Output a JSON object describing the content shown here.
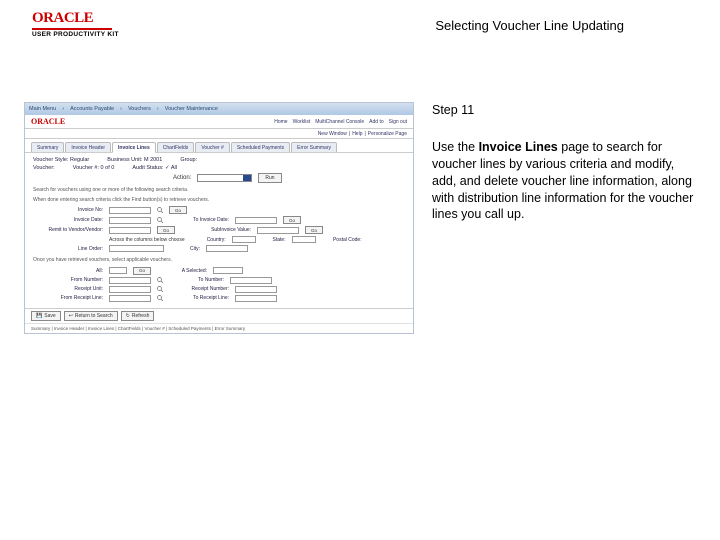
{
  "header": {
    "logo_text": "ORACLE",
    "logo_subtitle": "USER PRODUCTIVITY KIT",
    "title": "Selecting Voucher Line Updating"
  },
  "right_panel": {
    "step_label": "Step 11",
    "body_before_bold": "Use the ",
    "body_bold": "Invoice Lines",
    "body_after_bold": " page to search for voucher lines by various criteria and modify, add, and delete voucher line information, along with distribution line information for the voucher lines you call up."
  },
  "mini": {
    "breadcrumb": [
      "Main Menu",
      "Accounts Payable",
      "Vouchers",
      "Voucher Maintenance"
    ],
    "oracle_logo": "ORACLE",
    "top_links": [
      "Home",
      "Worklist",
      "MultiChannel Console",
      "Add to",
      "Sign out"
    ],
    "subbar_links": [
      "New Window",
      "Help",
      "Personalize Page"
    ],
    "tabs": [
      "Summary",
      "Invoice Header",
      "Invoice Lines",
      "ChartFields",
      "Voucher #",
      "Scheduled Payments",
      "Error Summary"
    ],
    "active_tab_index": 2,
    "header_fields": {
      "style_label": "Voucher Style:",
      "style_value": "Regular",
      "bu_label": "Business Unit:",
      "bu_value": "M 2001",
      "group_label": "Group:",
      "voucher_label": "Voucher:",
      "voucher_value": "",
      "voucher_label2": "Voucher #:",
      "voucher_value2": "0 of 0",
      "audit_label": "Audit Status:",
      "audit_value": "✓ All"
    },
    "action_label": "Action:",
    "run_btn": "Run",
    "instr1": "Search for vouchers using one or more of the following search criteria.",
    "instr2": "When done entering search criteria click the Find button(s) to retrieve vouchers.",
    "rows": [
      {
        "l1": "Invoice No:",
        "go": "Go"
      },
      {
        "l1": "Invoice Date:",
        "l2": "To Invoice Date:",
        "go": "Go"
      },
      {
        "l1": "Remit to Vendor/Vendor:",
        "go": "Go",
        "l2": "SubInvoice Value:",
        "go2": "Go"
      },
      {
        "l1": "",
        "mid": "Across the columns below choose",
        "l2": "Country:",
        "l3": "State:",
        "l4": "Postal Code:"
      },
      {
        "l1": "Line Order:",
        "l2": "City:"
      }
    ],
    "instr3": "Once you have retrieved vouchers, select applicable vouchers.",
    "rows2": [
      {
        "l1": "All:",
        "go": "Go",
        "l2": "A Selected:"
      },
      {
        "l1": "From Number:",
        "l2": "To Number:"
      },
      {
        "l1": "Receipt Unit:",
        "l2": "Receipt Number:"
      },
      {
        "l1": "From Receipt Line:",
        "l2": "To Receipt Line:"
      }
    ],
    "bottom_buttons": [
      "Save",
      "Return to Search",
      "Refresh"
    ],
    "footer_text": "Summary | Invoice Header | Invoice Lines | ChartFields | Voucher # | Scheduled Payments | Error Summary"
  }
}
